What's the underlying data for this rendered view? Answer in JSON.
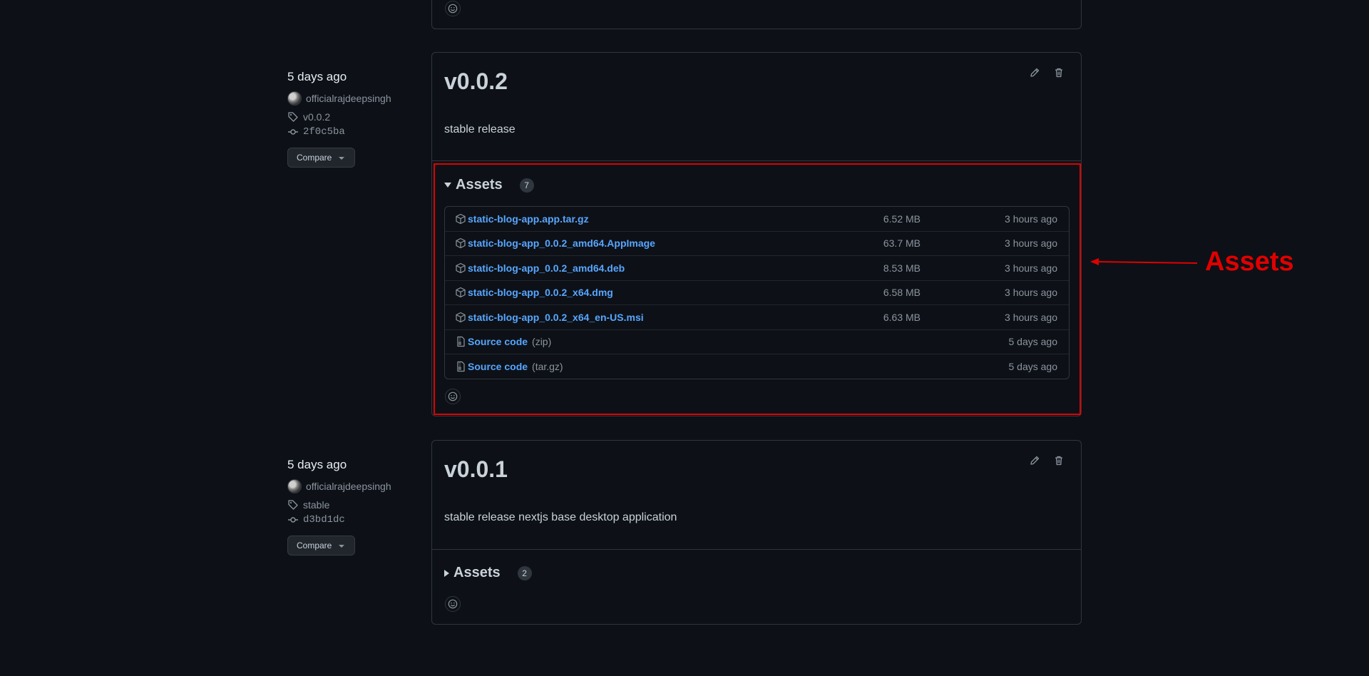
{
  "releases": [
    {
      "date": "5 days ago",
      "author": "officialrajdeepsingh",
      "tag": "v0.0.2",
      "commit": "2f0c5ba",
      "compare_label": "Compare",
      "title": "v0.0.2",
      "description": "stable release",
      "assets_label": "Assets",
      "assets_count": "7",
      "assets": [
        {
          "name": "static-blog-app.app.tar.gz",
          "size": "6.52 MB",
          "time": "3 hours ago"
        },
        {
          "name": "static-blog-app_0.0.2_amd64.AppImage",
          "size": "63.7 MB",
          "time": "3 hours ago"
        },
        {
          "name": "static-blog-app_0.0.2_amd64.deb",
          "size": "8.53 MB",
          "time": "3 hours ago"
        },
        {
          "name": "static-blog-app_0.0.2_x64.dmg",
          "size": "6.58 MB",
          "time": "3 hours ago"
        },
        {
          "name": "static-blog-app_0.0.2_x64_en-US.msi",
          "size": "6.63 MB",
          "time": "3 hours ago"
        }
      ],
      "sources": [
        {
          "name": "Source code",
          "format": "(zip)",
          "time": "5 days ago"
        },
        {
          "name": "Source code",
          "format": "(tar.gz)",
          "time": "5 days ago"
        }
      ]
    },
    {
      "date": "5 days ago",
      "author": "officialrajdeepsingh",
      "tag": "stable",
      "commit": "d3bd1dc",
      "compare_label": "Compare",
      "title": "v0.0.1",
      "description": "stable release nextjs base desktop application",
      "assets_label": "Assets",
      "assets_count": "2"
    }
  ],
  "annotation": {
    "label": "Assets",
    "color": "#e00000"
  },
  "icons": {
    "edit": "pencil-icon",
    "delete": "trash-icon",
    "tag": "tag-icon",
    "commit": "commit-icon",
    "package": "package-icon",
    "zip": "file-zip-icon",
    "react": "smiley-icon"
  }
}
